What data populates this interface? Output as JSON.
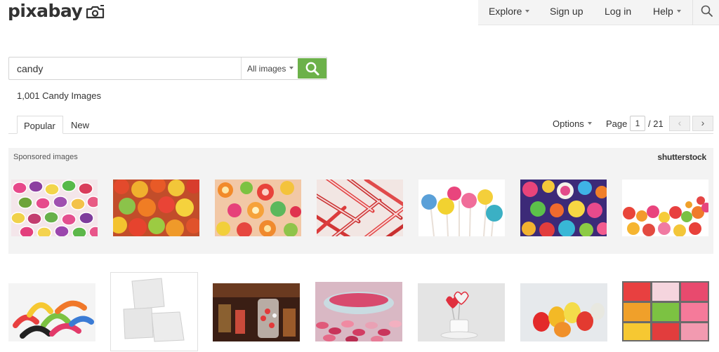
{
  "header": {
    "logo_text": "pixabay",
    "nav": {
      "explore": "Explore",
      "signup": "Sign up",
      "login": "Log in",
      "help": "Help"
    }
  },
  "search": {
    "query": "candy",
    "type_label": "All images"
  },
  "results": {
    "count_text": "1,001 Candy Images"
  },
  "tabs": {
    "popular": "Popular",
    "new": "New"
  },
  "toolbar": {
    "options_label": "Options",
    "page_label": "Page",
    "page_value": "1",
    "page_total": "/ 21",
    "prev_glyph": "‹",
    "next_glyph": "›"
  },
  "sponsored": {
    "label": "Sponsored images",
    "brand": "shutterstock"
  },
  "colors": {
    "search_button": "#6cb14a",
    "sponsored_bg": "#f3f3f3"
  }
}
